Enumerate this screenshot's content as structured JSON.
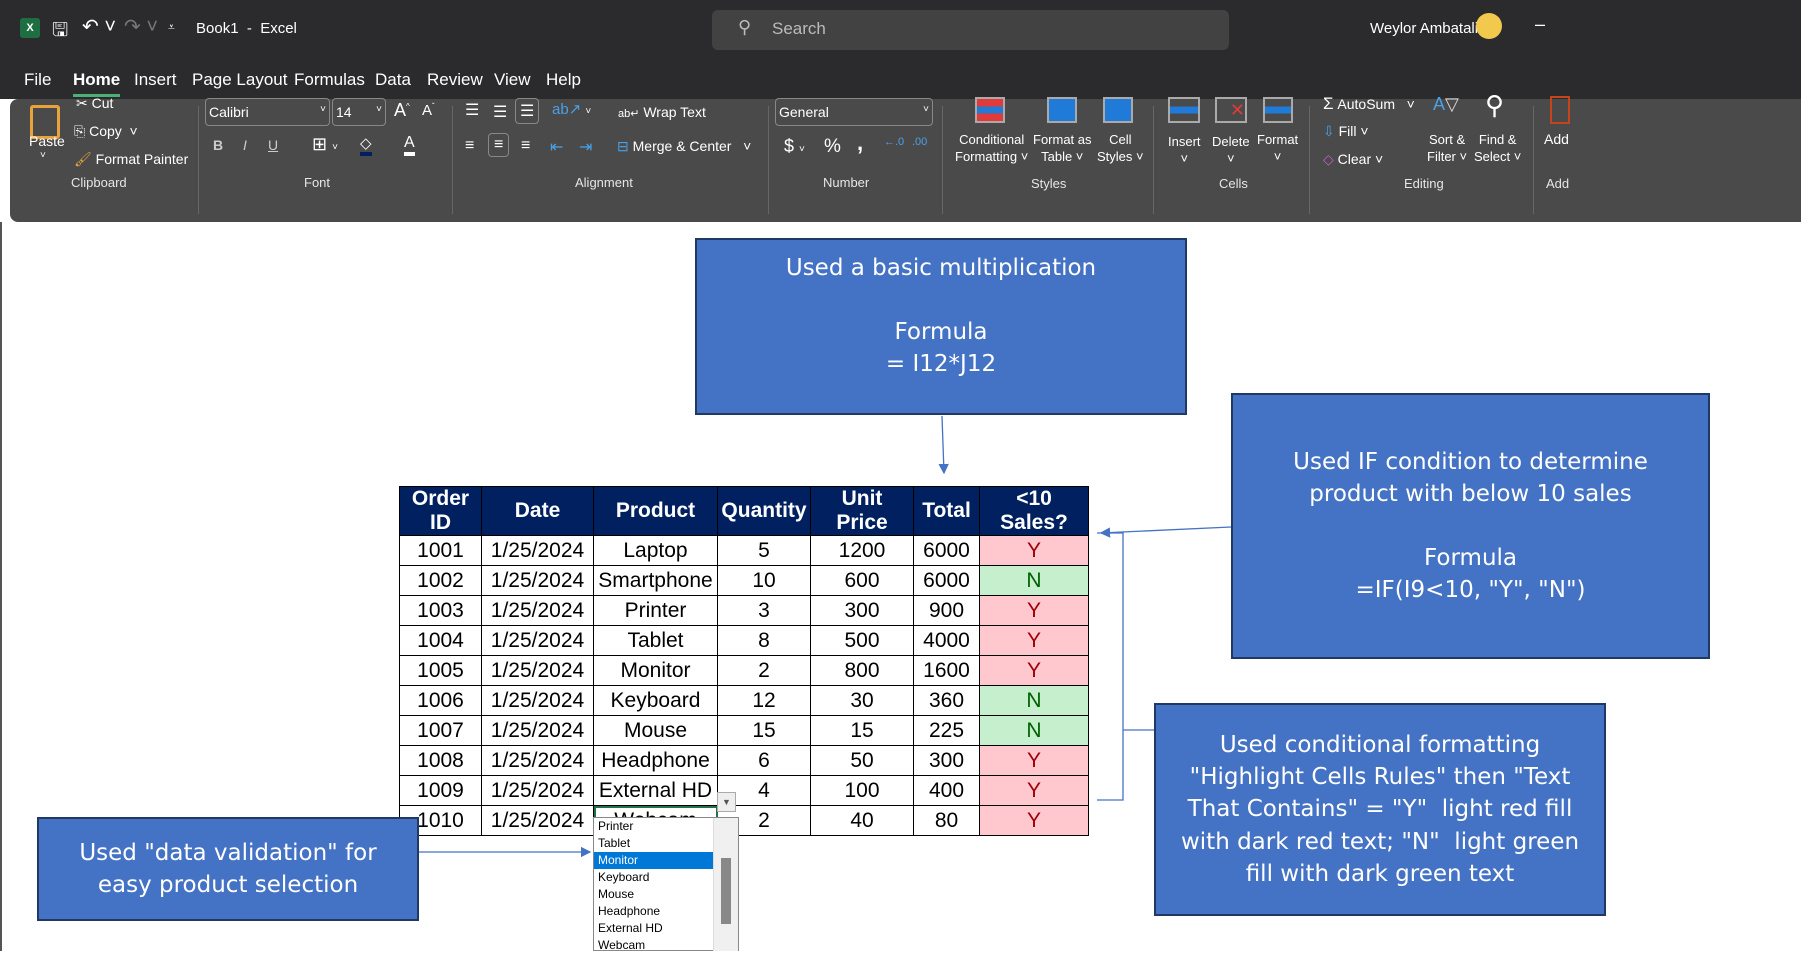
{
  "titlebar": {
    "doc_title": "Book1  -  Excel",
    "search_placeholder": "Search",
    "user_name": "Weylor Ambatali",
    "minimize": "–"
  },
  "menu_tabs": [
    "File",
    "Home",
    "Insert",
    "Page Layout",
    "Formulas",
    "Data",
    "Review",
    "View",
    "Help"
  ],
  "ribbon": {
    "clipboard": {
      "paste": "Paste",
      "cut": "Cut",
      "copy": "Copy",
      "format_painter": "Format Painter",
      "label": "Clipboard"
    },
    "font": {
      "font_name": "Calibri",
      "font_size": "14",
      "bold": "B",
      "italic": "I",
      "underline": "U",
      "label": "Font"
    },
    "alignment": {
      "wrap_text": "Wrap Text",
      "merge_center": "Merge & Center",
      "label": "Alignment"
    },
    "number": {
      "format": "General",
      "currency": "$",
      "percent": "%",
      "comma": ",",
      "label": "Number"
    },
    "styles": {
      "conditional": [
        "Conditional",
        "Formatting"
      ],
      "format_table": [
        "Format as",
        "Table"
      ],
      "cell_styles": [
        "Cell",
        "Styles"
      ],
      "label": "Styles"
    },
    "cells": {
      "insert": "Insert",
      "delete": "Delete",
      "format": "Format",
      "label": "Cells"
    },
    "editing": {
      "autosum": "AutoSum",
      "fill": "Fill",
      "clear": "Clear",
      "sort": [
        "Sort &",
        "Filter"
      ],
      "find": [
        "Find &",
        "Select"
      ],
      "label": "Editing"
    },
    "addins": {
      "label": "Add"
    }
  },
  "table": {
    "headers": [
      "Order ID",
      "Date",
      "Product",
      "Quantity",
      "Unit Price",
      "Total",
      "<10 Sales?"
    ],
    "rows": [
      [
        "1001",
        "1/25/2024",
        "Laptop",
        "5",
        "1200",
        "6000",
        "Y"
      ],
      [
        "1002",
        "1/25/2024",
        "Smartphone",
        "10",
        "600",
        "6000",
        "N"
      ],
      [
        "1003",
        "1/25/2024",
        "Printer",
        "3",
        "300",
        "900",
        "Y"
      ],
      [
        "1004",
        "1/25/2024",
        "Tablet",
        "8",
        "500",
        "4000",
        "Y"
      ],
      [
        "1005",
        "1/25/2024",
        "Monitor",
        "2",
        "800",
        "1600",
        "Y"
      ],
      [
        "1006",
        "1/25/2024",
        "Keyboard",
        "12",
        "30",
        "360",
        "N"
      ],
      [
        "1007",
        "1/25/2024",
        "Mouse",
        "15",
        "15",
        "225",
        "N"
      ],
      [
        "1008",
        "1/25/2024",
        "Headphone",
        "6",
        "50",
        "300",
        "Y"
      ],
      [
        "1009",
        "1/25/2024",
        "External HD",
        "4",
        "100",
        "400",
        "Y"
      ],
      [
        "1010",
        "1/25/2024",
        "Webcam",
        "2",
        "40",
        "80",
        "Y"
      ]
    ]
  },
  "dropdown": {
    "items": [
      "Printer",
      "Tablet",
      "Monitor",
      "Keyboard",
      "Mouse",
      "Headphone",
      "External HD",
      "Webcam"
    ],
    "highlighted": "Monitor"
  },
  "callouts": {
    "multiplication": [
      "Used a basic multiplication",
      "",
      "Formula",
      "= I12*J12"
    ],
    "if_condition": [
      "Used IF condition to determine",
      "product with below 10 sales",
      "",
      "Formula",
      "=IF(I9<10, \"Y\", \"N\")"
    ],
    "conditional_formatting": [
      "Used conditional formatting",
      "\"Highlight Cells Rules\" then \"Text",
      "That Contains\" = \"Y\"  light red fill",
      "with dark red text; \"N\"  light green",
      "fill with dark green text"
    ],
    "data_validation": [
      "Used \"data validation\" for",
      "easy product selection"
    ]
  },
  "colors": {
    "header_fill": "#002060",
    "y_fill": "#ffc7ce",
    "y_text": "#9c0006",
    "n_fill": "#c6efce",
    "n_text": "#006100",
    "callout": "#4472c4"
  }
}
